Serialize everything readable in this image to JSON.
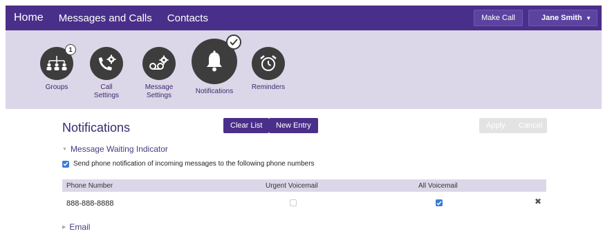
{
  "nav": {
    "home": "Home",
    "messages_calls": "Messages and Calls",
    "contacts": "Contacts",
    "make_call": "Make Call",
    "user_name": "Jane Smith"
  },
  "icons": [
    {
      "label": "Groups",
      "icon": "groups-icon",
      "badge": "1"
    },
    {
      "label": "Call Settings",
      "icon": "call-settings-icon"
    },
    {
      "label": "Message Settings",
      "icon": "message-settings-icon"
    },
    {
      "label": "Notifications",
      "icon": "bell-icon",
      "selected": true
    },
    {
      "label": "Reminders",
      "icon": "alarm-clock-icon"
    }
  ],
  "page": {
    "title": "Notifications",
    "clear_list": "Clear List",
    "new_entry": "New Entry",
    "apply": "Apply",
    "cancel": "Cancel"
  },
  "mwi": {
    "section_title": "Message Waiting Indicator",
    "send_notification_label": "Send phone notification of incoming messages to the following phone numbers",
    "send_notification_checked": true
  },
  "table": {
    "headers": {
      "phone_number": "Phone Number",
      "urgent_voicemail": "Urgent Voicemail",
      "all_voicemail": "All Voicemail"
    },
    "rows": [
      {
        "phone": "888-888-8888",
        "urgent": false,
        "all": true
      }
    ]
  },
  "email": {
    "section_title": "Email"
  },
  "colors": {
    "brand_purple": "#4a2f8a",
    "band_lavender": "#dcd7e8",
    "icon_dark": "#3d3d3d",
    "checkbox_blue": "#3a7bd5"
  }
}
